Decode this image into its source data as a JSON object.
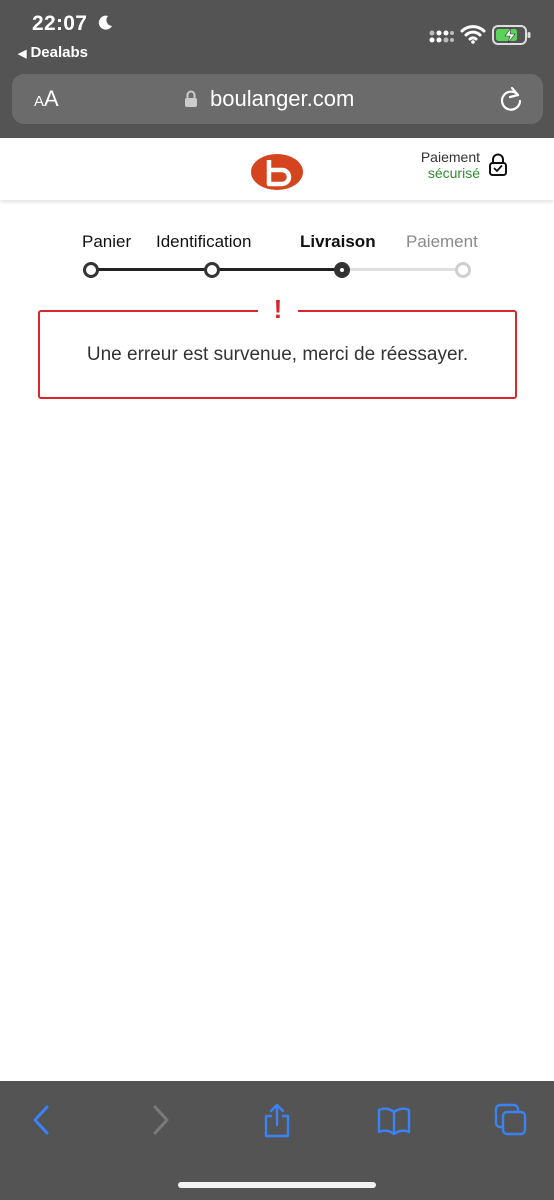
{
  "status_bar": {
    "time": "22:07",
    "back_app": "Dealabs"
  },
  "url_bar": {
    "aa_small": "A",
    "aa_big": "A",
    "url": "boulanger.com"
  },
  "header": {
    "secure_line1": "Paiement",
    "secure_line2": "sécurisé"
  },
  "steps": [
    {
      "label": "Panier",
      "state": "done"
    },
    {
      "label": "Identification",
      "state": "done"
    },
    {
      "label": "Livraison",
      "state": "active"
    },
    {
      "label": "Paiement",
      "state": "future"
    }
  ],
  "error": {
    "mark": "!",
    "message": "Une erreur est survenue, merci de réessayer."
  },
  "colors": {
    "brand": "#d4451f",
    "error": "#d8262c",
    "secure_green": "#2e8b2e",
    "toolbar_icon": "#3b82f6"
  }
}
